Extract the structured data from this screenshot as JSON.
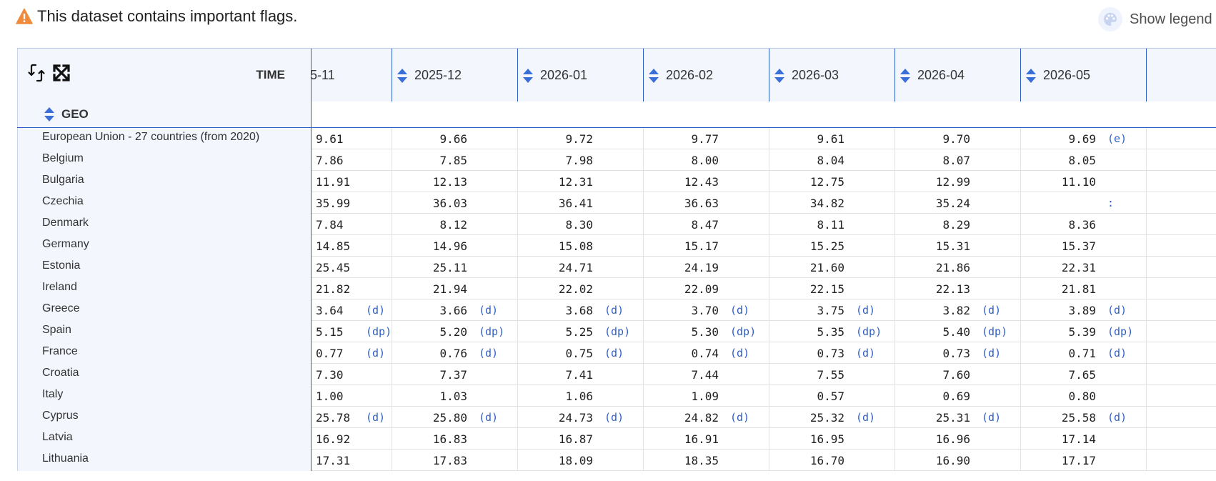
{
  "banner": {
    "text": "This dataset contains important flags."
  },
  "legend": {
    "label": "Show legend"
  },
  "table": {
    "time_label": "TIME",
    "geo_label": "GEO",
    "columns": [
      "5-11",
      "2025-12",
      "2026-01",
      "2026-02",
      "2026-03",
      "2026-04",
      "2026-05"
    ],
    "rows": [
      {
        "geo": "European Union - 27 countries (from 2020)",
        "cells": [
          {
            "v": "9.61",
            "f": ""
          },
          {
            "v": "9.66",
            "f": ""
          },
          {
            "v": "9.72",
            "f": ""
          },
          {
            "v": "9.77",
            "f": ""
          },
          {
            "v": "9.61",
            "f": ""
          },
          {
            "v": "9.70",
            "f": ""
          },
          {
            "v": "9.69",
            "f": "(e)"
          }
        ]
      },
      {
        "geo": "Belgium",
        "cells": [
          {
            "v": "7.86",
            "f": ""
          },
          {
            "v": "7.85",
            "f": ""
          },
          {
            "v": "7.98",
            "f": ""
          },
          {
            "v": "8.00",
            "f": ""
          },
          {
            "v": "8.04",
            "f": ""
          },
          {
            "v": "8.07",
            "f": ""
          },
          {
            "v": "8.05",
            "f": ""
          }
        ]
      },
      {
        "geo": "Bulgaria",
        "cells": [
          {
            "v": "11.91",
            "f": ""
          },
          {
            "v": "12.13",
            "f": ""
          },
          {
            "v": "12.31",
            "f": ""
          },
          {
            "v": "12.43",
            "f": ""
          },
          {
            "v": "12.75",
            "f": ""
          },
          {
            "v": "12.99",
            "f": ""
          },
          {
            "v": "11.10",
            "f": ""
          }
        ]
      },
      {
        "geo": "Czechia",
        "cells": [
          {
            "v": "35.99",
            "f": ""
          },
          {
            "v": "36.03",
            "f": ""
          },
          {
            "v": "36.41",
            "f": ""
          },
          {
            "v": "36.63",
            "f": ""
          },
          {
            "v": "34.82",
            "f": ""
          },
          {
            "v": "35.24",
            "f": ""
          },
          {
            "v": "",
            "f": ":"
          }
        ]
      },
      {
        "geo": "Denmark",
        "cells": [
          {
            "v": "7.84",
            "f": ""
          },
          {
            "v": "8.12",
            "f": ""
          },
          {
            "v": "8.30",
            "f": ""
          },
          {
            "v": "8.47",
            "f": ""
          },
          {
            "v": "8.11",
            "f": ""
          },
          {
            "v": "8.29",
            "f": ""
          },
          {
            "v": "8.36",
            "f": ""
          }
        ]
      },
      {
        "geo": "Germany",
        "cells": [
          {
            "v": "14.85",
            "f": ""
          },
          {
            "v": "14.96",
            "f": ""
          },
          {
            "v": "15.08",
            "f": ""
          },
          {
            "v": "15.17",
            "f": ""
          },
          {
            "v": "15.25",
            "f": ""
          },
          {
            "v": "15.31",
            "f": ""
          },
          {
            "v": "15.37",
            "f": ""
          }
        ]
      },
      {
        "geo": "Estonia",
        "cells": [
          {
            "v": "25.45",
            "f": ""
          },
          {
            "v": "25.11",
            "f": ""
          },
          {
            "v": "24.71",
            "f": ""
          },
          {
            "v": "24.19",
            "f": ""
          },
          {
            "v": "21.60",
            "f": ""
          },
          {
            "v": "21.86",
            "f": ""
          },
          {
            "v": "22.31",
            "f": ""
          }
        ]
      },
      {
        "geo": "Ireland",
        "cells": [
          {
            "v": "21.82",
            "f": ""
          },
          {
            "v": "21.94",
            "f": ""
          },
          {
            "v": "22.02",
            "f": ""
          },
          {
            "v": "22.09",
            "f": ""
          },
          {
            "v": "22.15",
            "f": ""
          },
          {
            "v": "22.13",
            "f": ""
          },
          {
            "v": "21.81",
            "f": ""
          }
        ]
      },
      {
        "geo": "Greece",
        "cells": [
          {
            "v": "3.64",
            "f": "(d)"
          },
          {
            "v": "3.66",
            "f": "(d)"
          },
          {
            "v": "3.68",
            "f": "(d)"
          },
          {
            "v": "3.70",
            "f": "(d)"
          },
          {
            "v": "3.75",
            "f": "(d)"
          },
          {
            "v": "3.82",
            "f": "(d)"
          },
          {
            "v": "3.89",
            "f": "(d)"
          }
        ]
      },
      {
        "geo": "Spain",
        "cells": [
          {
            "v": "5.15",
            "f": "(dp)"
          },
          {
            "v": "5.20",
            "f": "(dp)"
          },
          {
            "v": "5.25",
            "f": "(dp)"
          },
          {
            "v": "5.30",
            "f": "(dp)"
          },
          {
            "v": "5.35",
            "f": "(dp)"
          },
          {
            "v": "5.40",
            "f": "(dp)"
          },
          {
            "v": "5.39",
            "f": "(dp)"
          }
        ]
      },
      {
        "geo": "France",
        "cells": [
          {
            "v": "0.77",
            "f": "(d)"
          },
          {
            "v": "0.76",
            "f": "(d)"
          },
          {
            "v": "0.75",
            "f": "(d)"
          },
          {
            "v": "0.74",
            "f": "(d)"
          },
          {
            "v": "0.73",
            "f": "(d)"
          },
          {
            "v": "0.73",
            "f": "(d)"
          },
          {
            "v": "0.71",
            "f": "(d)"
          }
        ]
      },
      {
        "geo": "Croatia",
        "cells": [
          {
            "v": "7.30",
            "f": ""
          },
          {
            "v": "7.37",
            "f": ""
          },
          {
            "v": "7.41",
            "f": ""
          },
          {
            "v": "7.44",
            "f": ""
          },
          {
            "v": "7.55",
            "f": ""
          },
          {
            "v": "7.60",
            "f": ""
          },
          {
            "v": "7.65",
            "f": ""
          }
        ]
      },
      {
        "geo": "Italy",
        "cells": [
          {
            "v": "1.00",
            "f": ""
          },
          {
            "v": "1.03",
            "f": ""
          },
          {
            "v": "1.06",
            "f": ""
          },
          {
            "v": "1.09",
            "f": ""
          },
          {
            "v": "0.57",
            "f": ""
          },
          {
            "v": "0.69",
            "f": ""
          },
          {
            "v": "0.80",
            "f": ""
          }
        ]
      },
      {
        "geo": "Cyprus",
        "cells": [
          {
            "v": "25.78",
            "f": "(d)"
          },
          {
            "v": "25.80",
            "f": "(d)"
          },
          {
            "v": "24.73",
            "f": "(d)"
          },
          {
            "v": "24.82",
            "f": "(d)"
          },
          {
            "v": "25.32",
            "f": "(d)"
          },
          {
            "v": "25.31",
            "f": "(d)"
          },
          {
            "v": "25.58",
            "f": "(d)"
          }
        ]
      },
      {
        "geo": "Latvia",
        "cells": [
          {
            "v": "16.92",
            "f": ""
          },
          {
            "v": "16.83",
            "f": ""
          },
          {
            "v": "16.87",
            "f": ""
          },
          {
            "v": "16.91",
            "f": ""
          },
          {
            "v": "16.95",
            "f": ""
          },
          {
            "v": "16.96",
            "f": ""
          },
          {
            "v": "17.14",
            "f": ""
          }
        ]
      },
      {
        "geo": "Lithuania",
        "cells": [
          {
            "v": "17.31",
            "f": ""
          },
          {
            "v": "17.83",
            "f": ""
          },
          {
            "v": "18.09",
            "f": ""
          },
          {
            "v": "18.35",
            "f": ""
          },
          {
            "v": "16.70",
            "f": ""
          },
          {
            "v": "16.90",
            "f": ""
          },
          {
            "v": "17.17",
            "f": ""
          }
        ]
      }
    ]
  },
  "colors": {
    "accent": "#2f5fc4",
    "header_bg": "#f3f6fd",
    "warning": "#f08a3c",
    "sort_icon": "#3a6fd8"
  },
  "icons": {
    "warning": "warning-icon",
    "legend": "palette-icon",
    "swap": "swap-axes-icon",
    "fullscreen": "fullscreen-icon",
    "sort": "sort-icon"
  }
}
